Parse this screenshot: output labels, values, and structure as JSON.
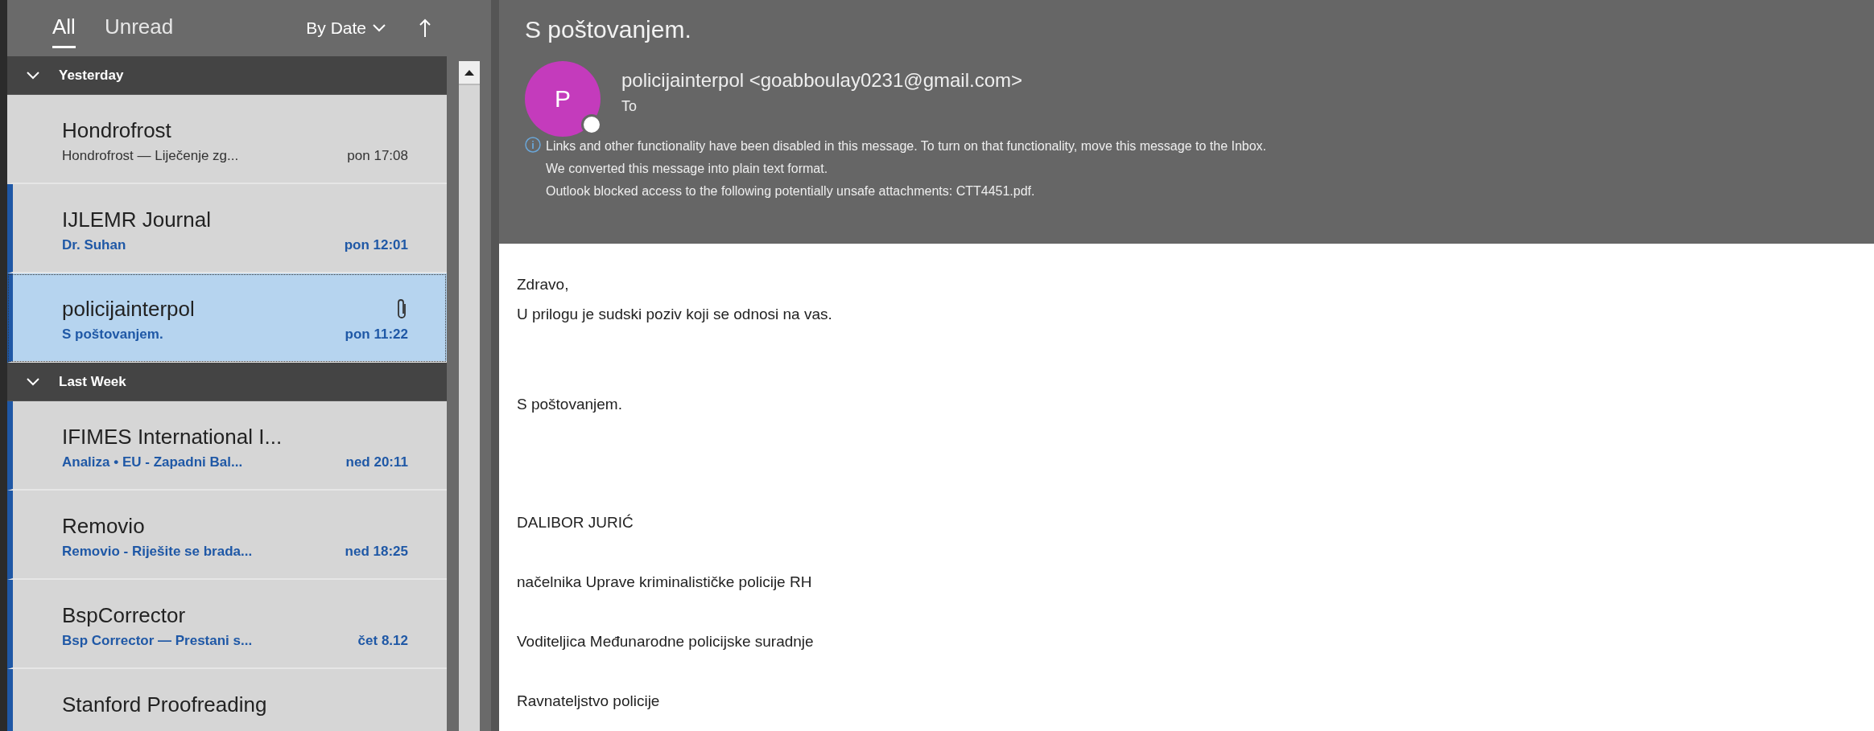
{
  "list_header": {
    "tabs": [
      {
        "label": "All",
        "selected": true
      },
      {
        "label": "Unread",
        "selected": false
      }
    ],
    "sort": "By Date"
  },
  "groups": [
    {
      "label": "Yesterday",
      "expanded": true,
      "items": [
        {
          "sender": "Hondrofrost",
          "preview": "Hondrofrost — Liječenje zg...",
          "time": "pon 17:08",
          "unread": false,
          "selected": false,
          "attachment": false
        },
        {
          "sender": "IJLEMR Journal",
          "preview": "Dr. Suhan",
          "time": "pon 12:01",
          "unread": true,
          "selected": false,
          "attachment": false
        },
        {
          "sender": "policijainterpol",
          "preview": "S poštovanjem.",
          "time": "pon 11:22",
          "unread": true,
          "selected": true,
          "attachment": true
        }
      ]
    },
    {
      "label": "Last Week",
      "expanded": true,
      "items": [
        {
          "sender": "IFIMES International I...",
          "preview": "Analiza • EU - Zapadni Bal...",
          "time": "ned 20:11",
          "unread": true,
          "selected": false,
          "attachment": false
        },
        {
          "sender": "Removio",
          "preview": "Removio - Riješite se brada...",
          "time": "ned 18:25",
          "unread": true,
          "selected": false,
          "attachment": false
        },
        {
          "sender": "BspCorrector",
          "preview": "Bsp Corrector  — Prestani s...",
          "time": "čet 8.12",
          "unread": true,
          "selected": false,
          "attachment": false
        },
        {
          "sender": "Stanford Proofreading",
          "unread": true,
          "selected": false,
          "attachment": false
        }
      ]
    }
  ],
  "message": {
    "subject": "S poštovanjem.",
    "avatar_letter": "P",
    "from": "policijainterpol <goabboulay0231@gmail.com>",
    "to": "To",
    "notices": [
      "Links and other functionality have been disabled in this message. To turn on that functionality, move this message to the Inbox.",
      "We converted this message into plain text format.",
      "Outlook blocked access to the following potentially unsafe attachments: CTT4451.pdf."
    ],
    "body": [
      "Zdravo,",
      "U prilogu je sudski poziv koji se odnosi na vas.",
      "S poštovanjem.",
      "DALIBOR JURIĆ",
      "načelnika Uprave kriminalističke policije RH",
      "Voditeljica Međunarodne policijske suradnje",
      "Ravnateljstvo policije"
    ]
  }
}
